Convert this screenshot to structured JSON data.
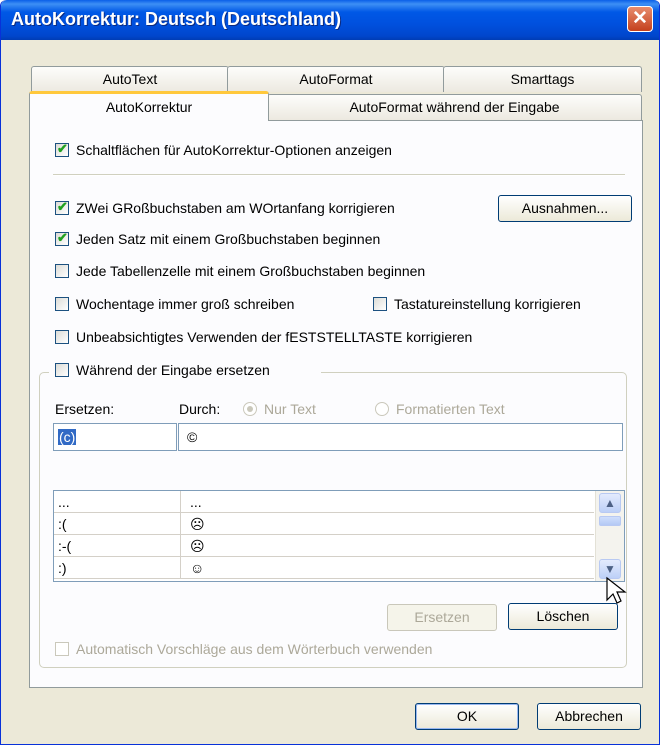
{
  "window": {
    "title": "AutoKorrektur: Deutsch (Deutschland)",
    "close_glyph": "✕"
  },
  "tabs": {
    "row1": [
      "AutoText",
      "AutoFormat",
      "Smarttags"
    ],
    "row2": [
      "AutoKorrektur",
      "AutoFormat während der Eingabe"
    ],
    "active": "AutoKorrektur"
  },
  "options": {
    "show_buttons": {
      "label": "Schaltflächen für AutoKorrektur-Optionen anzeigen",
      "checked": true
    },
    "two_caps": {
      "label": "ZWei GRoßbuchstaben am WOrtanfang korrigieren",
      "checked": true
    },
    "sentence_caps": {
      "label": "Jeden Satz mit einem Großbuchstaben beginnen",
      "checked": true
    },
    "table_caps": {
      "label": "Jede Tabellenzelle mit einem Großbuchstaben beginnen",
      "checked": false
    },
    "weekdays": {
      "label": "Wochentage immer groß schreiben",
      "checked": false
    },
    "keyboard": {
      "label": "Tastatureinstellung korrigieren",
      "checked": false
    },
    "capslock": {
      "label": "Unbeabsichtigtes Verwenden der fESTSTELLTASTE korrigieren",
      "checked": false
    },
    "replace_while_typing": {
      "label": "Während der Eingabe ersetzen",
      "checked": false
    }
  },
  "buttons": {
    "exceptions": "Ausnahmen...",
    "replace": "Ersetzen",
    "delete": "Löschen",
    "ok": "OK",
    "cancel": "Abbrechen"
  },
  "replace_group": {
    "replace_label": "Ersetzen:",
    "with_label": "Durch:",
    "radio_plain": "Nur Text",
    "radio_formatted": "Formatierten Text",
    "replace_value": "(c)",
    "with_value": "©"
  },
  "entries": [
    {
      "from": "...",
      "to": "..."
    },
    {
      "from": ":(",
      "to": "☹"
    },
    {
      "from": ":-(",
      "to": "☹"
    },
    {
      "from": ":)",
      "to": "☺"
    }
  ],
  "suggestions": {
    "label": "Automatisch Vorschläge aus dem Wörterbuch verwenden",
    "checked": false
  },
  "colors": {
    "title_bar": "#0054e3",
    "tab_highlight": "#ffc83c",
    "check": "#21a121",
    "dialog_bg": "#ece9d8"
  }
}
